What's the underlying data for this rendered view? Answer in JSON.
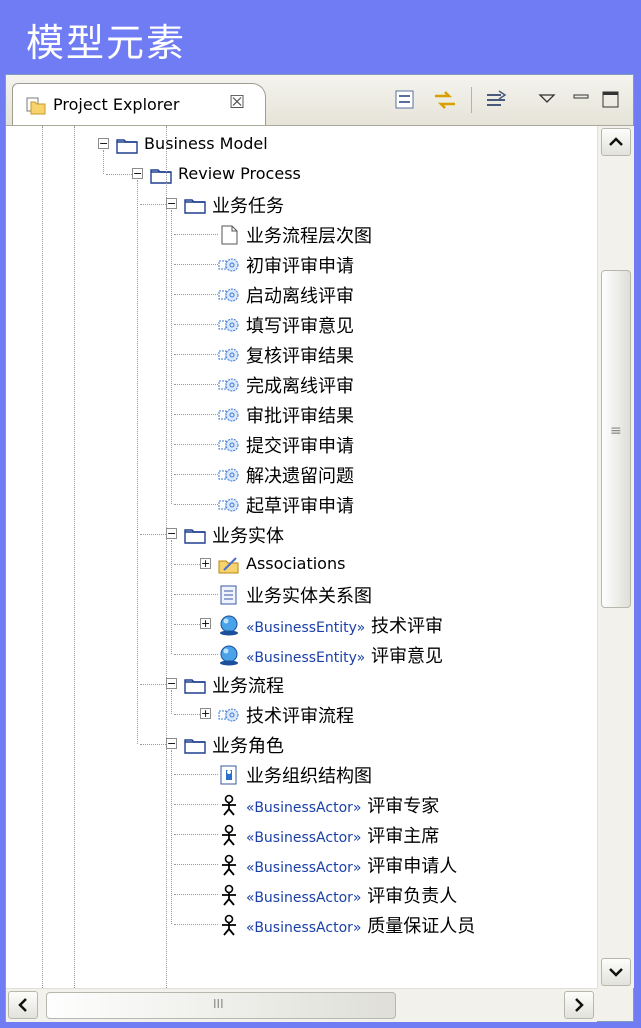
{
  "banner": {
    "title": "模型元素"
  },
  "view": {
    "tab_label": "Project Explorer",
    "tab_close": "☒",
    "toolbar": [
      "collapse-all-icon",
      "link-with-editor-icon",
      "filter-icon",
      "view-menu-icon",
      "minimize-icon",
      "maximize-icon"
    ]
  },
  "tree": [
    {
      "label": "Business Model",
      "icon": "folder-icon",
      "expander": "minus"
    },
    {
      "label": "Review Process",
      "icon": "folder-icon",
      "expander": "minus"
    },
    {
      "label": "业务任务",
      "icon": "folder-icon",
      "expander": "minus"
    },
    {
      "label": "业务流程层次图",
      "icon": "diagram-icon"
    },
    {
      "label": "初审评审申请",
      "icon": "task-icon"
    },
    {
      "label": "启动离线评审",
      "icon": "task-icon"
    },
    {
      "label": "填写评审意见",
      "icon": "task-icon"
    },
    {
      "label": "复核评审结果",
      "icon": "task-icon"
    },
    {
      "label": "完成离线评审",
      "icon": "task-icon"
    },
    {
      "label": "审批评审结果",
      "icon": "task-icon"
    },
    {
      "label": "提交评审申请",
      "icon": "task-icon"
    },
    {
      "label": "解决遗留问题",
      "icon": "task-icon"
    },
    {
      "label": "起草评审申请",
      "icon": "task-icon"
    },
    {
      "label": "业务实体",
      "icon": "folder-icon",
      "expander": "minus"
    },
    {
      "label": "Associations",
      "icon": "association-folder-icon",
      "expander": "plus"
    },
    {
      "label": "业务实体关系图",
      "icon": "entity-diagram-icon"
    },
    {
      "stereo": "«BusinessEntity»",
      "label": "技术评审",
      "icon": "entity-icon",
      "expander": "plus"
    },
    {
      "stereo": "«BusinessEntity»",
      "label": "评审意见",
      "icon": "entity-icon"
    },
    {
      "label": "业务流程",
      "icon": "folder-icon",
      "expander": "minus"
    },
    {
      "label": "技术评审流程",
      "icon": "task-icon",
      "expander": "plus"
    },
    {
      "label": "业务角色",
      "icon": "folder-icon",
      "expander": "minus"
    },
    {
      "label": "业务组织结构图",
      "icon": "org-diagram-icon"
    },
    {
      "stereo": "«BusinessActor»",
      "label": "评审专家",
      "icon": "actor-icon"
    },
    {
      "stereo": "«BusinessActor»",
      "label": "评审主席",
      "icon": "actor-icon"
    },
    {
      "stereo": "«BusinessActor»",
      "label": "评审申请人",
      "icon": "actor-icon"
    },
    {
      "stereo": "«BusinessActor»",
      "label": "评审负责人",
      "icon": "actor-icon"
    },
    {
      "stereo": "«BusinessActor»",
      "label": "质量保证人员",
      "icon": "actor-icon"
    }
  ],
  "scroll": {
    "up": "▲",
    "down": "▼",
    "left": "◀",
    "right": "▶",
    "grip": "≡",
    "hgrip": "III"
  },
  "colors": {
    "banner": "#6f7cf4",
    "accent": "#1a3fa8"
  }
}
